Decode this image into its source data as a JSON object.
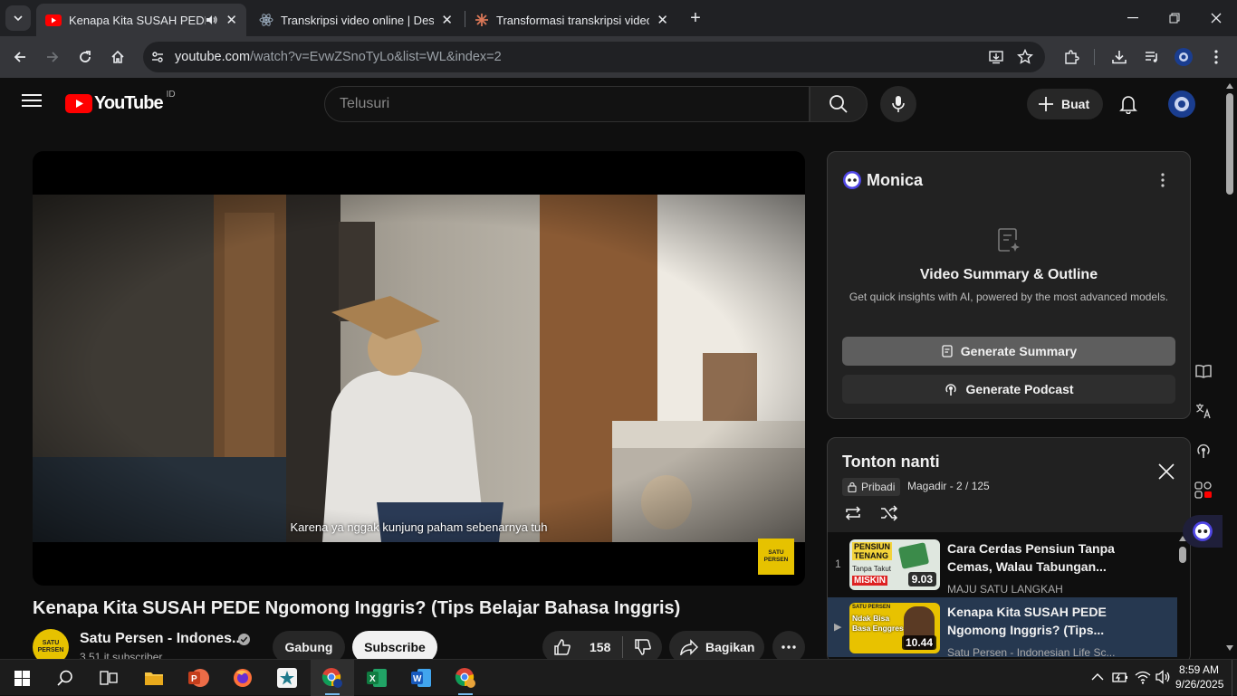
{
  "browser": {
    "tabs": [
      {
        "title": "Kenapa Kita SUSAH PEDE N",
        "active": true
      },
      {
        "title": "Transkripsi video online | Desgr",
        "active": false
      },
      {
        "title": "Transformasi transkripsi video n",
        "active": false
      }
    ],
    "url_host": "youtube.com",
    "url_path": "/watch?v=EvwZSnoTyLo&list=WL&index=2"
  },
  "youtube": {
    "logo_text": "YouTube",
    "country": "ID",
    "search_placeholder": "Telusuri",
    "create_label": "Buat"
  },
  "video": {
    "caption": "Karena ya nggak kunjung paham sebenarnya tuh",
    "watermark": "SATU PERSEN",
    "title": "Kenapa Kita SUSAH PEDE Ngomong Inggris? (Tips Belajar Bahasa Inggris)",
    "channel_name": "Satu Persen - Indones...",
    "subscribers": "3,51 jt subscriber",
    "avatar_text": "SATU PERSEN",
    "join_label": "Gabung",
    "subscribe_label": "Subscribe",
    "likes": "158",
    "share_label": "Bagikan"
  },
  "monica": {
    "name": "Monica",
    "heading": "Video Summary & Outline",
    "subtitle": "Get quick insights with AI, powered by the most advanced models.",
    "generate_summary": "Generate Summary",
    "generate_podcast": "Generate Podcast"
  },
  "playlist": {
    "title": "Tonton nanti",
    "privacy": "Pribadi",
    "owner_progress": "Magadir - 2 / 125",
    "items": [
      {
        "index": "1",
        "title": "Cara Cerdas Pensiun Tanpa Cemas, Walau Tabungan...",
        "channel": "MAJU SATU LANGKAH",
        "duration": "9.03",
        "thumb_top": "PENSIUN TENANG",
        "thumb_mid": "Tanpa Takut",
        "thumb_bottom": "MISKIN"
      },
      {
        "index": "▶",
        "title": "Kenapa Kita SUSAH PEDE Ngomong Inggris? (Tips...",
        "channel": "Satu Persen - Indonesian Life Sc...",
        "duration": "10.44",
        "thumb_top": "Ndak Bisa Basa Enggres",
        "thumb_brand": "SATU PERSEN"
      }
    ]
  },
  "taskbar": {
    "time": "8:59 AM",
    "date": "9/26/2025"
  },
  "colors": {
    "youtube_red": "#ff0000",
    "accent_yellow": "#e6c200",
    "taskbar_blue": "#76b9ed"
  }
}
